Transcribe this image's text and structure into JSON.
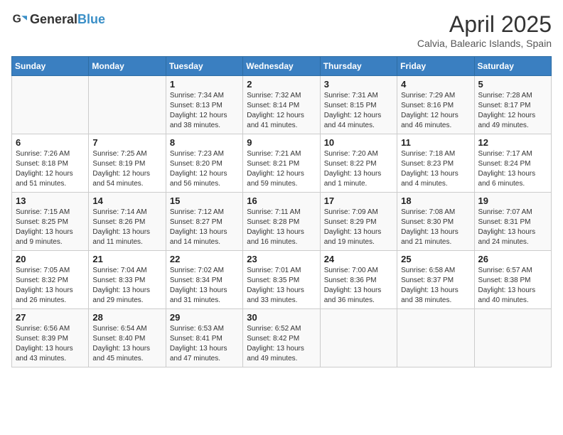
{
  "logo": {
    "text_general": "General",
    "text_blue": "Blue"
  },
  "title": "April 2025",
  "subtitle": "Calvia, Balearic Islands, Spain",
  "days_of_week": [
    "Sunday",
    "Monday",
    "Tuesday",
    "Wednesday",
    "Thursday",
    "Friday",
    "Saturday"
  ],
  "weeks": [
    [
      {
        "day": "",
        "info": ""
      },
      {
        "day": "",
        "info": ""
      },
      {
        "day": "1",
        "info": "Sunrise: 7:34 AM\nSunset: 8:13 PM\nDaylight: 12 hours and 38 minutes."
      },
      {
        "day": "2",
        "info": "Sunrise: 7:32 AM\nSunset: 8:14 PM\nDaylight: 12 hours and 41 minutes."
      },
      {
        "day": "3",
        "info": "Sunrise: 7:31 AM\nSunset: 8:15 PM\nDaylight: 12 hours and 44 minutes."
      },
      {
        "day": "4",
        "info": "Sunrise: 7:29 AM\nSunset: 8:16 PM\nDaylight: 12 hours and 46 minutes."
      },
      {
        "day": "5",
        "info": "Sunrise: 7:28 AM\nSunset: 8:17 PM\nDaylight: 12 hours and 49 minutes."
      }
    ],
    [
      {
        "day": "6",
        "info": "Sunrise: 7:26 AM\nSunset: 8:18 PM\nDaylight: 12 hours and 51 minutes."
      },
      {
        "day": "7",
        "info": "Sunrise: 7:25 AM\nSunset: 8:19 PM\nDaylight: 12 hours and 54 minutes."
      },
      {
        "day": "8",
        "info": "Sunrise: 7:23 AM\nSunset: 8:20 PM\nDaylight: 12 hours and 56 minutes."
      },
      {
        "day": "9",
        "info": "Sunrise: 7:21 AM\nSunset: 8:21 PM\nDaylight: 12 hours and 59 minutes."
      },
      {
        "day": "10",
        "info": "Sunrise: 7:20 AM\nSunset: 8:22 PM\nDaylight: 13 hours and 1 minute."
      },
      {
        "day": "11",
        "info": "Sunrise: 7:18 AM\nSunset: 8:23 PM\nDaylight: 13 hours and 4 minutes."
      },
      {
        "day": "12",
        "info": "Sunrise: 7:17 AM\nSunset: 8:24 PM\nDaylight: 13 hours and 6 minutes."
      }
    ],
    [
      {
        "day": "13",
        "info": "Sunrise: 7:15 AM\nSunset: 8:25 PM\nDaylight: 13 hours and 9 minutes."
      },
      {
        "day": "14",
        "info": "Sunrise: 7:14 AM\nSunset: 8:26 PM\nDaylight: 13 hours and 11 minutes."
      },
      {
        "day": "15",
        "info": "Sunrise: 7:12 AM\nSunset: 8:27 PM\nDaylight: 13 hours and 14 minutes."
      },
      {
        "day": "16",
        "info": "Sunrise: 7:11 AM\nSunset: 8:28 PM\nDaylight: 13 hours and 16 minutes."
      },
      {
        "day": "17",
        "info": "Sunrise: 7:09 AM\nSunset: 8:29 PM\nDaylight: 13 hours and 19 minutes."
      },
      {
        "day": "18",
        "info": "Sunrise: 7:08 AM\nSunset: 8:30 PM\nDaylight: 13 hours and 21 minutes."
      },
      {
        "day": "19",
        "info": "Sunrise: 7:07 AM\nSunset: 8:31 PM\nDaylight: 13 hours and 24 minutes."
      }
    ],
    [
      {
        "day": "20",
        "info": "Sunrise: 7:05 AM\nSunset: 8:32 PM\nDaylight: 13 hours and 26 minutes."
      },
      {
        "day": "21",
        "info": "Sunrise: 7:04 AM\nSunset: 8:33 PM\nDaylight: 13 hours and 29 minutes."
      },
      {
        "day": "22",
        "info": "Sunrise: 7:02 AM\nSunset: 8:34 PM\nDaylight: 13 hours and 31 minutes."
      },
      {
        "day": "23",
        "info": "Sunrise: 7:01 AM\nSunset: 8:35 PM\nDaylight: 13 hours and 33 minutes."
      },
      {
        "day": "24",
        "info": "Sunrise: 7:00 AM\nSunset: 8:36 PM\nDaylight: 13 hours and 36 minutes."
      },
      {
        "day": "25",
        "info": "Sunrise: 6:58 AM\nSunset: 8:37 PM\nDaylight: 13 hours and 38 minutes."
      },
      {
        "day": "26",
        "info": "Sunrise: 6:57 AM\nSunset: 8:38 PM\nDaylight: 13 hours and 40 minutes."
      }
    ],
    [
      {
        "day": "27",
        "info": "Sunrise: 6:56 AM\nSunset: 8:39 PM\nDaylight: 13 hours and 43 minutes."
      },
      {
        "day": "28",
        "info": "Sunrise: 6:54 AM\nSunset: 8:40 PM\nDaylight: 13 hours and 45 minutes."
      },
      {
        "day": "29",
        "info": "Sunrise: 6:53 AM\nSunset: 8:41 PM\nDaylight: 13 hours and 47 minutes."
      },
      {
        "day": "30",
        "info": "Sunrise: 6:52 AM\nSunset: 8:42 PM\nDaylight: 13 hours and 49 minutes."
      },
      {
        "day": "",
        "info": ""
      },
      {
        "day": "",
        "info": ""
      },
      {
        "day": "",
        "info": ""
      }
    ]
  ]
}
